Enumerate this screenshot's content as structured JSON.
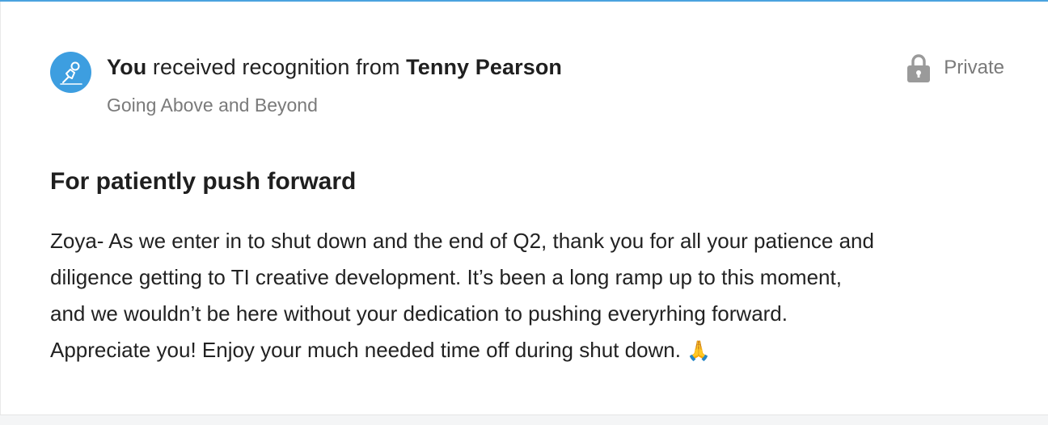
{
  "colors": {
    "accent": "#4aa3df",
    "avatar_bg": "#3d9ee0",
    "muted_text": "#7a7a7a",
    "lock_icon": "#9a9a9a"
  },
  "header": {
    "avatar_icon": "climber-icon",
    "recipient": "You",
    "connector": " received recognition from ",
    "sender": "Tenny Pearson",
    "category": "Going Above and Beyond",
    "privacy": {
      "icon": "lock-icon",
      "label": "Private"
    }
  },
  "recognition": {
    "title": "For patiently push forward",
    "message_lines": [
      "Zoya- As we enter in to shut down and the end of Q2, thank you for all your patience and",
      "diligence getting to TI creative development. It’s been a long ramp up to this moment,",
      "and we wouldn’t be here without your dedication to pushing everyrhing forward.",
      "Appreciate you! Enjoy your much needed time off during shut down."
    ],
    "emoji": "🙏"
  }
}
